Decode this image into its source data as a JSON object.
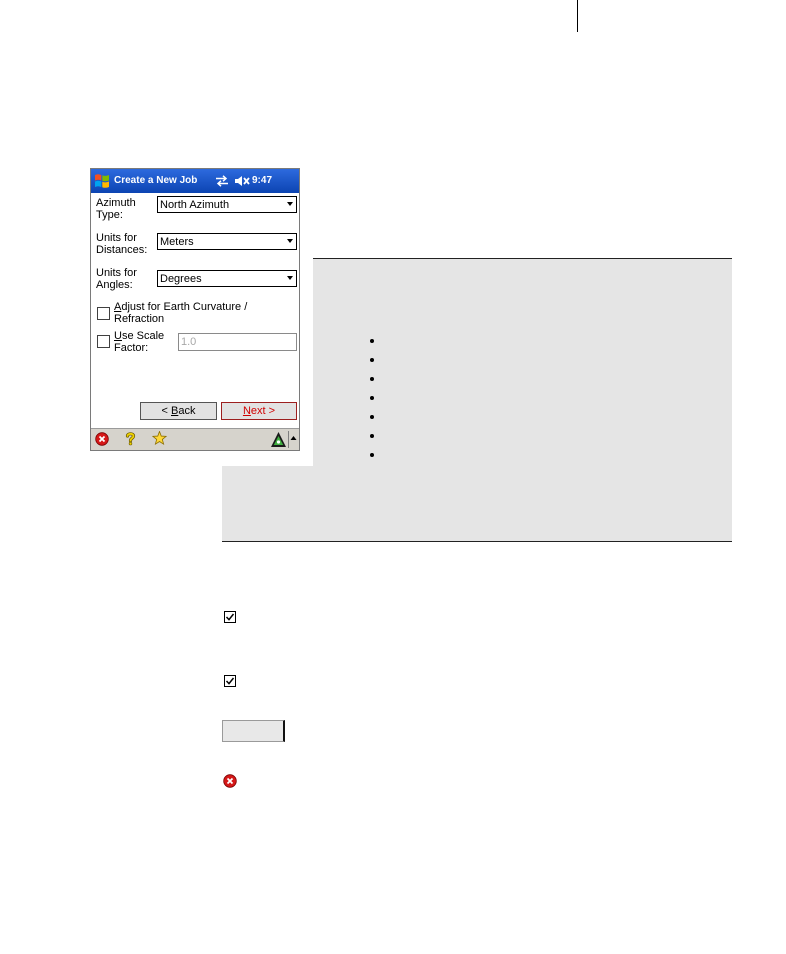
{
  "device": {
    "title": "Create a New Job",
    "clock": "9:47",
    "azimuth_type": {
      "label": "Azimuth Type:",
      "value": "North Azimuth"
    },
    "distance_units": {
      "label": "Units for Distances:",
      "value": "Meters"
    },
    "angle_units": {
      "label": "Units for Angles:",
      "value": "Degrees"
    },
    "earth_curvature": {
      "label": "Adjust for Earth Curvature / Refraction",
      "checked": false
    },
    "scale_factor": {
      "label": "Use Scale Factor:",
      "checked": false,
      "value": "1.0"
    },
    "back_button": {
      "label": "< Back"
    },
    "next_button": {
      "label": "Next >"
    },
    "status_icons": [
      "windows-flag-icon",
      "sync-arrows-icon",
      "speaker-mute-icon"
    ],
    "toolbar_icons": [
      "close-icon",
      "help-icon",
      "favorites-star-icon",
      "survey-status-icon",
      "up-arrow-icon"
    ]
  },
  "document_icons": [
    "checkbox-checked-icon",
    "checkbox-checked-icon",
    "button-icon",
    "close-icon"
  ],
  "colors": {
    "title_bar": "#1a56c8",
    "callout_background": "#e5e5e5",
    "next_button_text": "#d00000",
    "close_icon": "#d51818"
  }
}
